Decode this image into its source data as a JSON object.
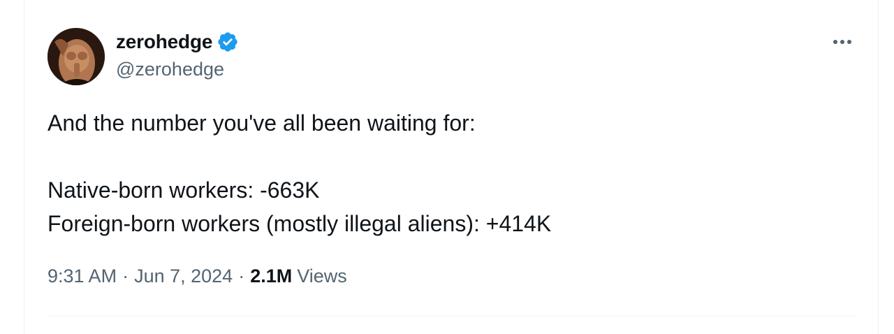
{
  "author": {
    "display_name": "zerohedge",
    "handle": "@zerohedge",
    "verified": true,
    "verified_color": "#1d9bf0"
  },
  "tweet": {
    "lines": [
      "And the number you've all been waiting for:",
      "",
      "Native-born workers: -663K",
      "Foreign-born workers (mostly illegal aliens): +414K"
    ]
  },
  "meta": {
    "time": "9:31 AM",
    "separator": "·",
    "date": "Jun 7, 2024",
    "views_count": "2.1M",
    "views_label": "Views"
  },
  "icons": {
    "more": "more-options-icon",
    "verified": "verified-badge-icon"
  }
}
